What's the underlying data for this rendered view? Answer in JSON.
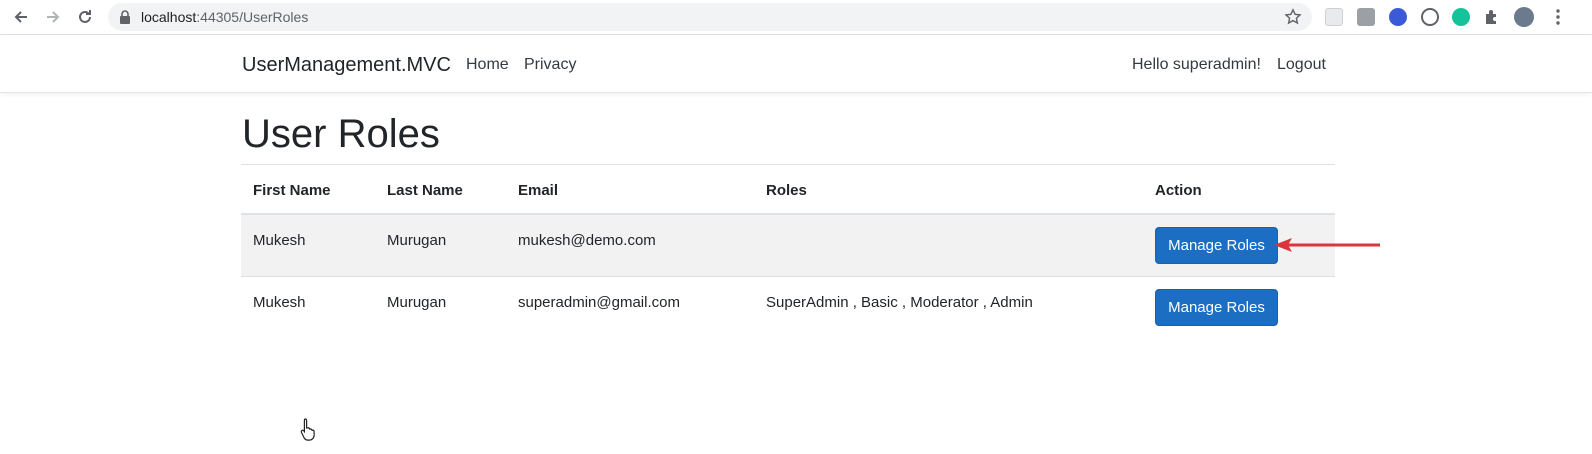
{
  "browser": {
    "url_host": "localhost",
    "url_path": ":44305/UserRoles",
    "icons": [
      "back-icon",
      "forward-icon",
      "reload-icon",
      "lock-icon",
      "star-icon",
      "puzzle-icon",
      "menu-icon"
    ]
  },
  "navbar": {
    "brand": "UserManagement.MVC",
    "links": [
      "Home",
      "Privacy"
    ],
    "greeting": "Hello superadmin!",
    "logout": "Logout"
  },
  "page": {
    "title": "User Roles"
  },
  "table": {
    "headers": [
      "First Name",
      "Last Name",
      "Email",
      "Roles",
      "Action"
    ],
    "rows": [
      {
        "first_name": "Mukesh",
        "last_name": "Murugan",
        "email": "mukesh@demo.com",
        "roles": "",
        "action": "Manage Roles"
      },
      {
        "first_name": "Mukesh",
        "last_name": "Murugan",
        "email": "superadmin@gmail.com",
        "roles": "SuperAdmin , Basic , Moderator , Admin",
        "action": "Manage Roles"
      }
    ]
  },
  "colors": {
    "primary_button": "#1b6ec2",
    "annotation_arrow": "#d9363e",
    "striped_row": "#f2f2f2"
  }
}
